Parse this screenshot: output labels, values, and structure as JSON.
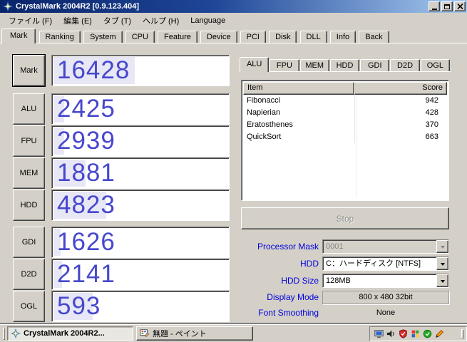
{
  "titlebar": {
    "title": "CrystalMark 2004R2 [0.9.123.404]",
    "window_controls": [
      "minimize-icon",
      "maximize-icon",
      "close-icon"
    ]
  },
  "menu": {
    "items": [
      "ファイル (F)",
      "編集 (E)",
      "タブ (T)",
      "ヘルプ (H)",
      "Language"
    ]
  },
  "main_tabs": {
    "active": "Mark",
    "items": [
      "Mark",
      "Ranking",
      "System",
      "CPU",
      "Feature",
      "Device",
      "PCI",
      "Disk",
      "DLL",
      "Info",
      "Back"
    ]
  },
  "benchmark": {
    "rows": [
      {
        "label": "Mark",
        "score": "16428",
        "progress": 46
      },
      {
        "label": "ALU",
        "score": "2425",
        "progress": 6
      },
      {
        "label": "FPU",
        "score": "2939",
        "progress": 6
      },
      {
        "label": "MEM",
        "score": "1881",
        "progress": 18
      },
      {
        "label": "HDD",
        "score": "4823",
        "progress": 30
      },
      {
        "label": "GDI",
        "score": "1626",
        "progress": 4
      },
      {
        "label": "D2D",
        "score": "2141",
        "progress": 5
      },
      {
        "label": "OGL",
        "score": "593",
        "progress": 22
      }
    ]
  },
  "detail": {
    "active_tab": "ALU",
    "tabs": [
      "ALU",
      "FPU",
      "MEM",
      "HDD",
      "GDI",
      "D2D",
      "OGL"
    ],
    "table": {
      "headers": {
        "item": "Item",
        "score": "Score"
      },
      "rows": [
        {
          "item": "Fibonacci",
          "score": "942"
        },
        {
          "item": "Napierian",
          "score": "428"
        },
        {
          "item": "Eratosthenes",
          "score": "370"
        },
        {
          "item": "QuickSort",
          "score": "663"
        }
      ]
    },
    "stop_button": "Stop",
    "form": {
      "processor_mask": {
        "label": "Processor Mask",
        "value": "0001"
      },
      "hdd": {
        "label": "HDD",
        "value": "C：ハードディスク [NTFS]"
      },
      "hdd_size": {
        "label": "HDD Size",
        "value": "128MB"
      },
      "display_mode": {
        "label": "Display Mode",
        "value": "800 x 480 32bit"
      },
      "font_smoothing": {
        "label": "Font Smoothing",
        "value": "None"
      }
    }
  },
  "taskbar": {
    "buttons": [
      {
        "label": "CrystalMark 2004R2...",
        "active": true
      },
      {
        "label": "無題 - ペイント",
        "active": false
      }
    ],
    "tray_icons": [
      "display-icon",
      "volume-icon",
      "antivirus-shield-icon",
      "colorful-app-icon",
      "green-status-icon",
      "pen-icon"
    ]
  },
  "colors": {
    "chrome": "#d4d0c8",
    "score_text": "#4747cd",
    "form_label_blue": "#0000dd",
    "titlebar_left": "#0a246a",
    "titlebar_right": "#a6caf0"
  }
}
